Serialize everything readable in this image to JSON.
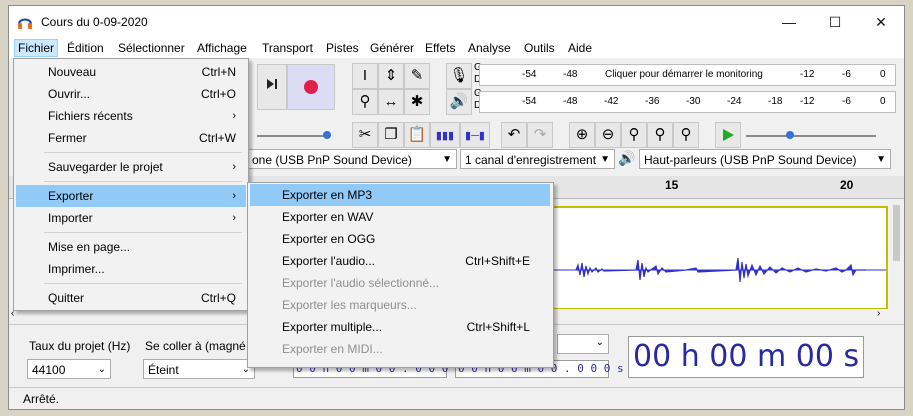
{
  "window": {
    "title": "Cours du 0-09-2020",
    "min_glyph": "—",
    "max_glyph": "☐",
    "close_glyph": "✕"
  },
  "menubar": {
    "items": [
      "Fichier",
      "Édition",
      "Sélectionner",
      "Affichage",
      "Transport",
      "Pistes",
      "Générer",
      "Effets",
      "Analyse",
      "Outils",
      "Aide"
    ],
    "active": "Fichier"
  },
  "file_menu": {
    "new": {
      "label": "Nouveau",
      "shortcut": "Ctrl+N"
    },
    "open": {
      "label": "Ouvrir...",
      "shortcut": "Ctrl+O"
    },
    "recent": {
      "label": "Fichiers récents"
    },
    "close": {
      "label": "Fermer",
      "shortcut": "Ctrl+W"
    },
    "save_project": {
      "label": "Sauvegarder le projet"
    },
    "export": {
      "label": "Exporter"
    },
    "import": {
      "label": "Importer"
    },
    "page_setup": {
      "label": "Mise en page..."
    },
    "print": {
      "label": "Imprimer..."
    },
    "quit": {
      "label": "Quitter",
      "shortcut": "Ctrl+Q"
    },
    "submenu_arrow": "›"
  },
  "export_menu": {
    "mp3": {
      "label": "Exporter en MP3"
    },
    "wav": {
      "label": "Exporter en WAV"
    },
    "ogg": {
      "label": "Exporter en OGG"
    },
    "audio": {
      "label": "Exporter l'audio...",
      "shortcut": "Ctrl+Shift+E"
    },
    "selected_audio": {
      "label": "Exporter l'audio sélectionné..."
    },
    "labels": {
      "label": "Exporter les marqueurs..."
    },
    "multiple": {
      "label": "Exporter multiple...",
      "shortcut": "Ctrl+Shift+L"
    },
    "midi": {
      "label": "Exporter en MIDI..."
    }
  },
  "meters": {
    "record_hint": "Cliquer pour démarrer le monitoring",
    "record_ticks": [
      "-54",
      "-48",
      "-12",
      "-6",
      "0"
    ],
    "play_ticks": [
      "-54",
      "-48",
      "-42",
      "-36",
      "-30",
      "-24",
      "-18",
      "-12",
      "-6",
      "0"
    ],
    "channel_labels": [
      "G",
      "D"
    ]
  },
  "devices": {
    "input_device": "one (USB PnP Sound Device)",
    "channels": "1 canal d'enregistrement",
    "output_device": "Haut-parleurs (USB PnP Sound Device)"
  },
  "ruler": {
    "ticks": [
      "15",
      "20"
    ]
  },
  "selection_toolbar": {
    "rate_label": "Taux du projet (Hz)",
    "rate_value": "44100",
    "snap_label": "Se coller à (magné",
    "snap_value": "Éteint",
    "start_time": "0 0 h 0 0 m 0 0 . 0 0 0 s",
    "end_time": "0 0 h 0 0 m 0 0 . 0 0 0 s",
    "audio_position": "00 h 00 m 00 s"
  },
  "status": {
    "text": "Arrêté."
  },
  "colors": {
    "waveform": "#3232c8",
    "highlight": "#91c9f7",
    "record_button": "#e0204a",
    "play_button": "#22aa22"
  }
}
